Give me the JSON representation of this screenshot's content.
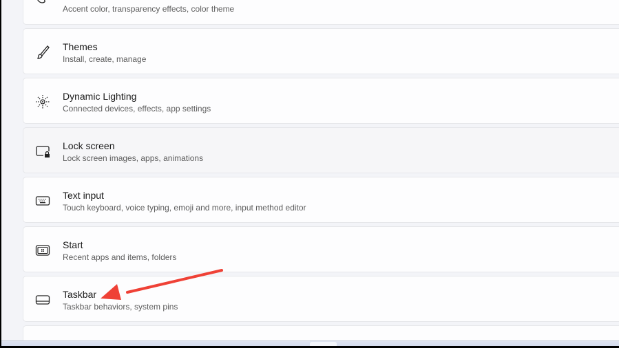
{
  "items": [
    {
      "title": "",
      "subtitle": "Accent color, transparency effects, color theme",
      "icon": "palette-icon"
    },
    {
      "title": "Themes",
      "subtitle": "Install, create, manage",
      "icon": "brush-icon"
    },
    {
      "title": "Dynamic Lighting",
      "subtitle": "Connected devices, effects, app settings",
      "icon": "lighting-icon"
    },
    {
      "title": "Lock screen",
      "subtitle": "Lock screen images, apps, animations",
      "icon": "lock-screen-icon"
    },
    {
      "title": "Text input",
      "subtitle": "Touch keyboard, voice typing, emoji and more, input method editor",
      "icon": "keyboard-icon"
    },
    {
      "title": "Start",
      "subtitle": "Recent apps and items, folders",
      "icon": "start-icon"
    },
    {
      "title": "Taskbar",
      "subtitle": "Taskbar behaviors, system pins",
      "icon": "taskbar-icon"
    }
  ],
  "annotation": {
    "color": "#ef4136"
  }
}
